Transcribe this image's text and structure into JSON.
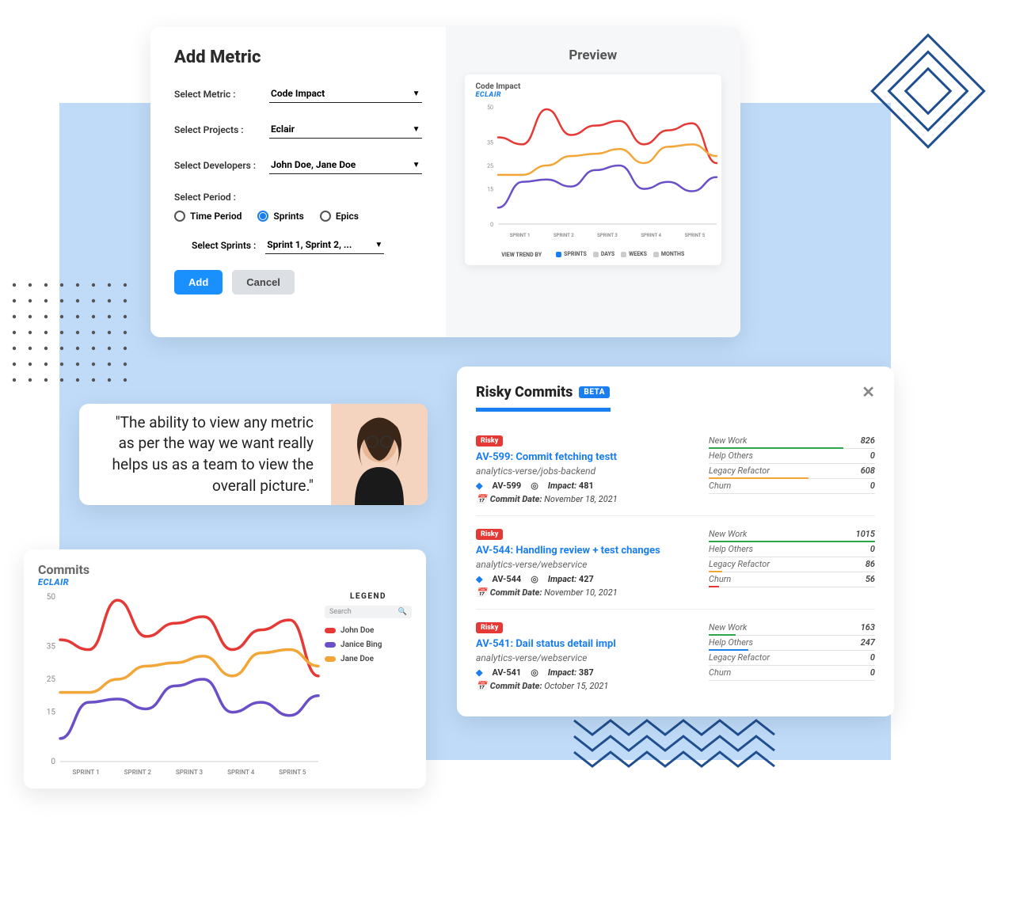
{
  "add_metric": {
    "title": "Add Metric",
    "preview_title": "Preview",
    "labels": {
      "metric": "Select Metric :",
      "projects": "Select Projects :",
      "developers": "Select Developers :",
      "period": "Select Period :",
      "sprints": "Select Sprints :"
    },
    "values": {
      "metric": "Code Impact",
      "projects": "Eclair",
      "developers": "John Doe, Jane Doe",
      "sprints": "Sprint 1, Sprint 2, ..."
    },
    "period_options": [
      {
        "label": "Time Period",
        "selected": false
      },
      {
        "label": "Sprints",
        "selected": true
      },
      {
        "label": "Epics",
        "selected": false
      }
    ],
    "buttons": {
      "add": "Add",
      "cancel": "Cancel"
    },
    "preview_chart": {
      "title": "Code Impact",
      "subtitle": "ECLAIR",
      "trend_label": "VIEW TREND BY",
      "trend_options": [
        "SPRINTS",
        "DAYS",
        "WEEKS",
        "MONTHS"
      ],
      "trend_selected": "SPRINTS"
    }
  },
  "testimonial": {
    "quote": "\"The ability to view any metric as per the way we want really helps us as a team to view the overall picture.\""
  },
  "commits_chart": {
    "title": "Commits",
    "subtitle": "ECLAIR",
    "legend_title": "LEGEND",
    "search_placeholder": "Search",
    "legend_items": [
      {
        "name": "John Doe",
        "color": "#e53935"
      },
      {
        "name": "Janice Bing",
        "color": "#6b4fc9"
      },
      {
        "name": "Jane Doe",
        "color": "#f2a638"
      }
    ]
  },
  "chart_data": {
    "type": "line",
    "title": "Commits — ECLAIR",
    "xlabel": "",
    "ylabel": "",
    "ylim": [
      0,
      50
    ],
    "categories": [
      "SPRINT 1",
      "SPRINT 2",
      "SPRINT 3",
      "SPRINT 4",
      "SPRINT 5"
    ],
    "series": [
      {
        "name": "John Doe",
        "color": "#e53935",
        "values": [
          37,
          34,
          49,
          38,
          42,
          44,
          34,
          40,
          43,
          26
        ]
      },
      {
        "name": "Janice Bing",
        "color": "#6b4fc9",
        "values": [
          7,
          18,
          19,
          16,
          23,
          25,
          15,
          18,
          14,
          20
        ]
      },
      {
        "name": "Jane Doe",
        "color": "#f2a638",
        "values": [
          21,
          21,
          25,
          29,
          30,
          32,
          26,
          33,
          34,
          29
        ]
      }
    ]
  },
  "risky_commits": {
    "title": "Risky Commits",
    "badge": "BETA",
    "stat_labels": {
      "new_work": "New Work",
      "help_others": "Help Others",
      "legacy_refactor": "Legacy Refactor",
      "churn": "Churn"
    },
    "impact_label": "Impact:",
    "commit_date_label": "Commit Date:",
    "tag": "Risky",
    "items": [
      {
        "title": "AV-599: Commit fetching testt",
        "repo": "analytics-verse/jobs-backend",
        "id": "AV-599",
        "impact": 481,
        "date": "November 18, 2021",
        "stats": {
          "new_work": 826,
          "help_others": 0,
          "legacy_refactor": 608,
          "churn": 0
        }
      },
      {
        "title": "AV-544: Handling review + test changes",
        "repo": "analytics-verse/webservice",
        "id": "AV-544",
        "impact": 427,
        "date": "November 10, 2021",
        "stats": {
          "new_work": 1015,
          "help_others": 0,
          "legacy_refactor": 86,
          "churn": 56
        }
      },
      {
        "title": "AV-541: Dail status detail impl",
        "repo": "analytics-verse/webservice",
        "id": "AV-541",
        "impact": 387,
        "date": "October 15, 2021",
        "stats": {
          "new_work": 163,
          "help_others": 247,
          "legacy_refactor": 0,
          "churn": 0
        }
      }
    ],
    "stat_colors": {
      "new_work": "#2aa84a",
      "help_others": "#1a7ef0",
      "legacy_refactor": "#f2a638",
      "churn": "#e53935"
    }
  }
}
